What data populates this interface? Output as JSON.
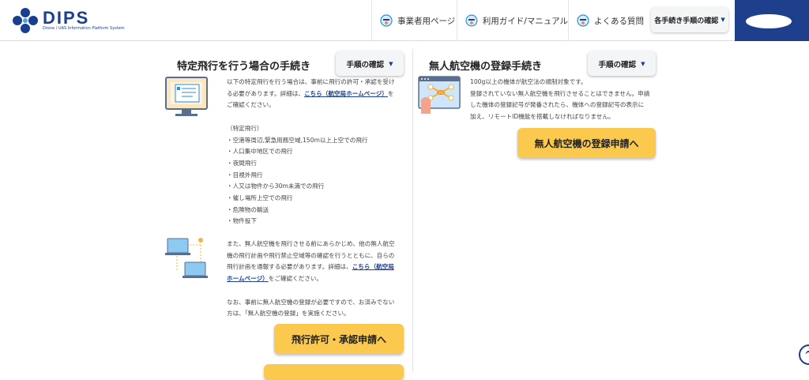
{
  "header": {
    "logo_text": "DIPS",
    "logo_subtitle": "Drone / UAS Information Platform System",
    "nav": [
      {
        "label": "事業者用ページ",
        "icon": "drone-globe-icon"
      },
      {
        "label": "利用ガイド/マニュアル",
        "icon": "drone-globe-icon"
      },
      {
        "label": "よくある質問",
        "icon": "drone-globe-icon"
      }
    ],
    "procedures_dropdown": "各手続き手順の確認"
  },
  "left": {
    "title": "特定飛行を行う場合の手続き",
    "step_button": "手順の確認",
    "intro": [
      "以下の特定飛行を行う場合は、事前に飛行の許可・承認を受け",
      "る必要があります。詳細は、"
    ],
    "link1": "こちら（航空局ホームページ）",
    "link1_after": "を",
    "intro_end": "ご確認ください。",
    "list_heading": "（特定飛行）",
    "items": [
      "・空港等周辺,緊急用務空域,150m以上上空での飛行",
      "・人口集中地区での飛行",
      "・夜間飛行",
      "・目視外飛行",
      "・人又は物件から30m未満での飛行",
      "・催し場所上空での飛行",
      "・危険物の輸送",
      "・物件投下"
    ],
    "para2": [
      "また、無人航空機を飛行させる前にあらかじめ、他の無人航空",
      "機の飛行計画や飛行禁止空域等の確認を行うとともに、自らの",
      "飛行計画を通報する必要があります。詳細は、"
    ],
    "link2a": "こちら（航空局",
    "link2b": "ホームページ）",
    "link2_after": "をご確認ください。",
    "para3": [
      "なお、事前に無人航空機の登録が必要ですので、お済みでない",
      "方は、「無人航空機の登録」を実施ください。"
    ],
    "cta": "飛行許可・承認申請へ"
  },
  "right": {
    "title": "無人航空機の登録手続き",
    "step_button": "手順の確認",
    "lines": [
      "100g以上の機体が航空法の規制対象です。",
      "登録されていない無人航空機を飛行させることはできません。申請",
      "した機体の登録記号が発番されたら、機体への登録記号の表示に",
      "加え、リモートID機能を搭載しなければなりません。"
    ],
    "cta": "無人航空機の登録申請へ"
  },
  "colors": {
    "brand": "#1d3f8c",
    "cta": "#fbc94d"
  }
}
